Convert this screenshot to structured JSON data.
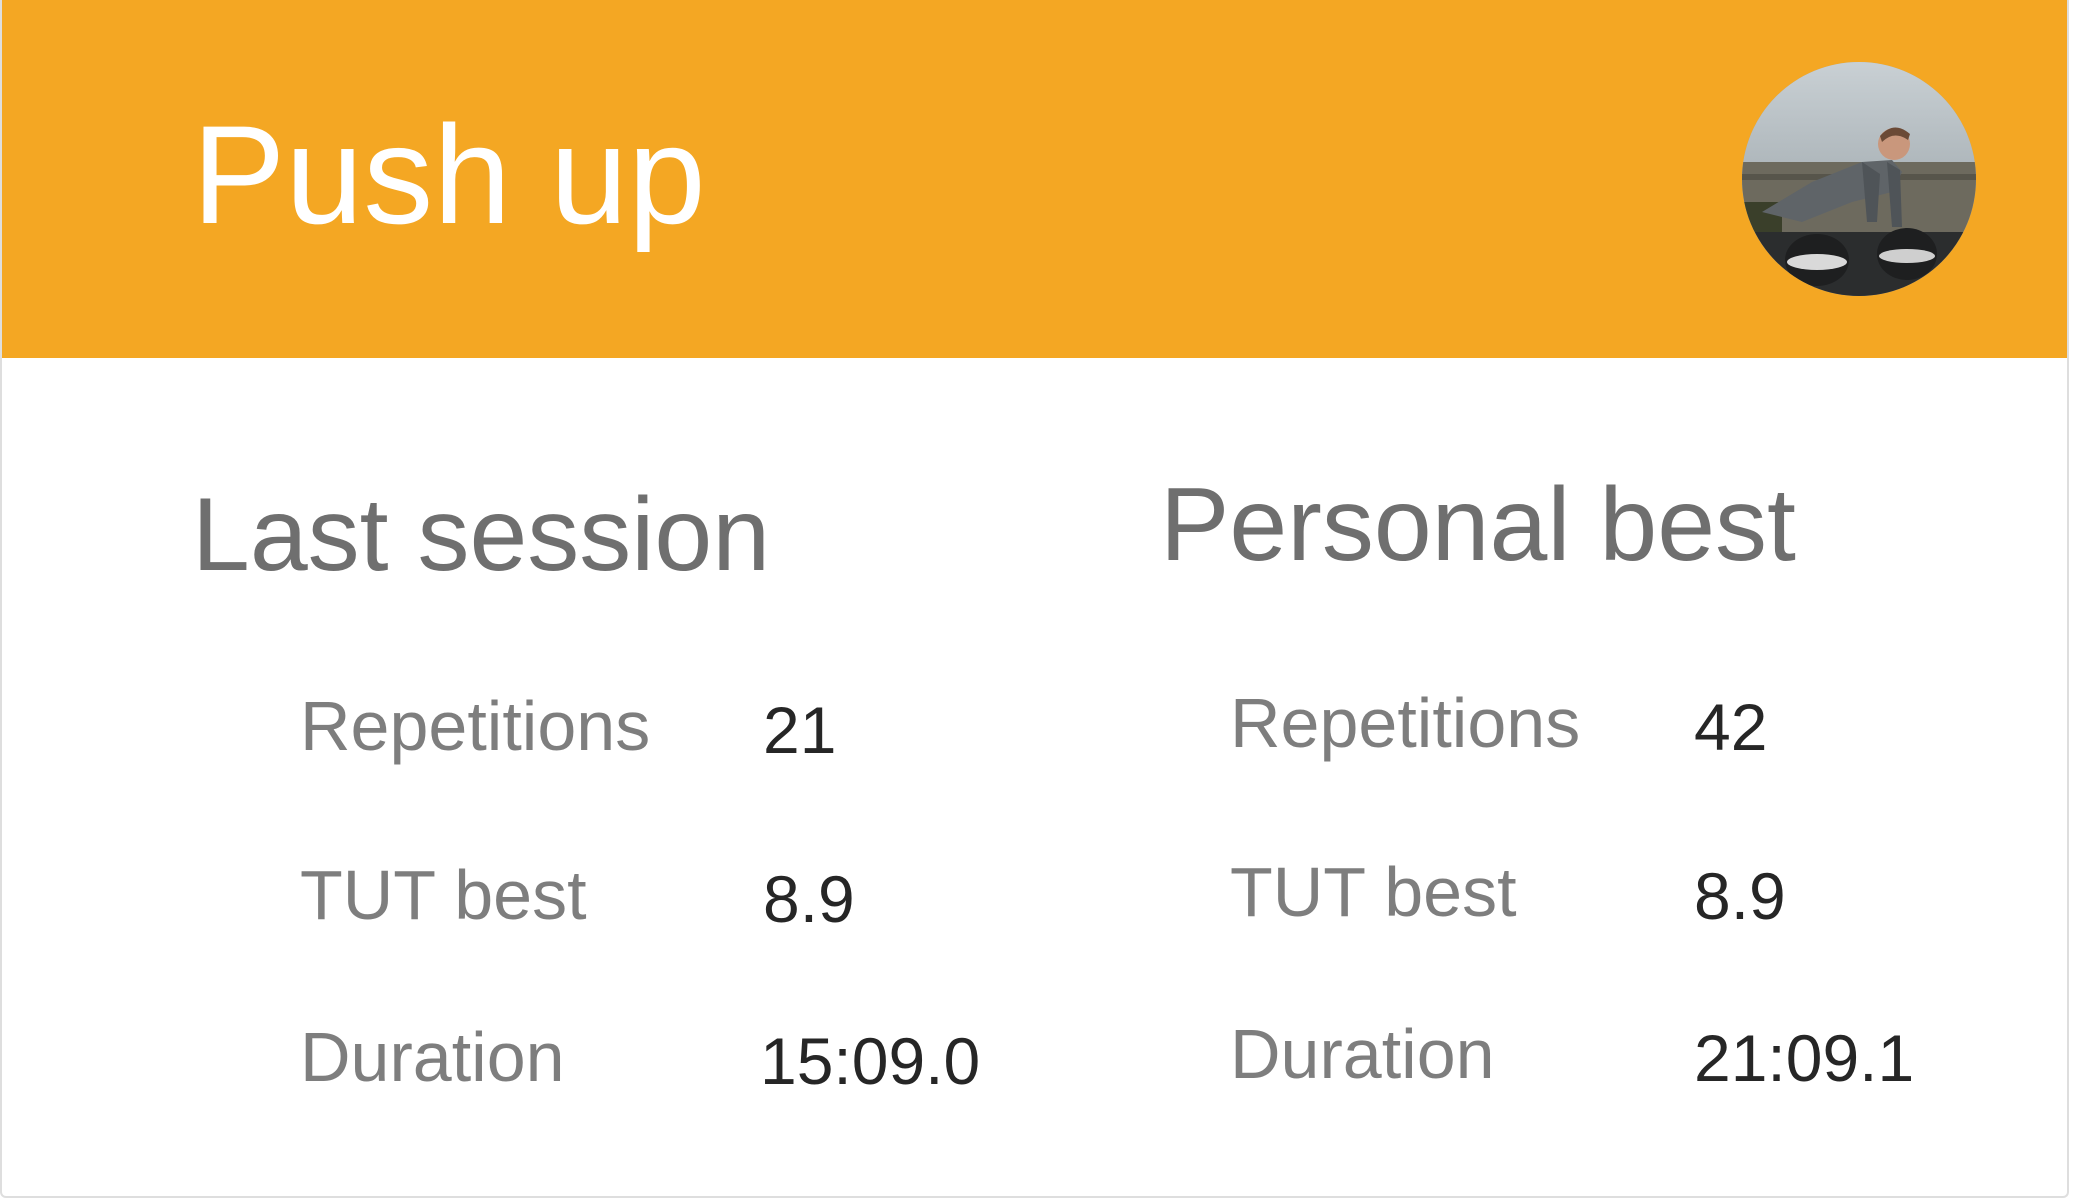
{
  "header": {
    "title": "Push up",
    "avatar_icon": "exercise-photo-avatar",
    "background_color": "#f4a723"
  },
  "last_session": {
    "heading": "Last session",
    "rows": [
      {
        "label": "Repetitions",
        "value": "21"
      },
      {
        "label": "TUT best",
        "value": "8.9"
      },
      {
        "label": "Duration",
        "value": "15:09.0"
      }
    ]
  },
  "personal_best": {
    "heading": "Personal best",
    "rows": [
      {
        "label": "Repetitions",
        "value": "42"
      },
      {
        "label": "TUT best",
        "value": "8.9"
      },
      {
        "label": "Duration",
        "value": "21:09.1"
      }
    ]
  }
}
